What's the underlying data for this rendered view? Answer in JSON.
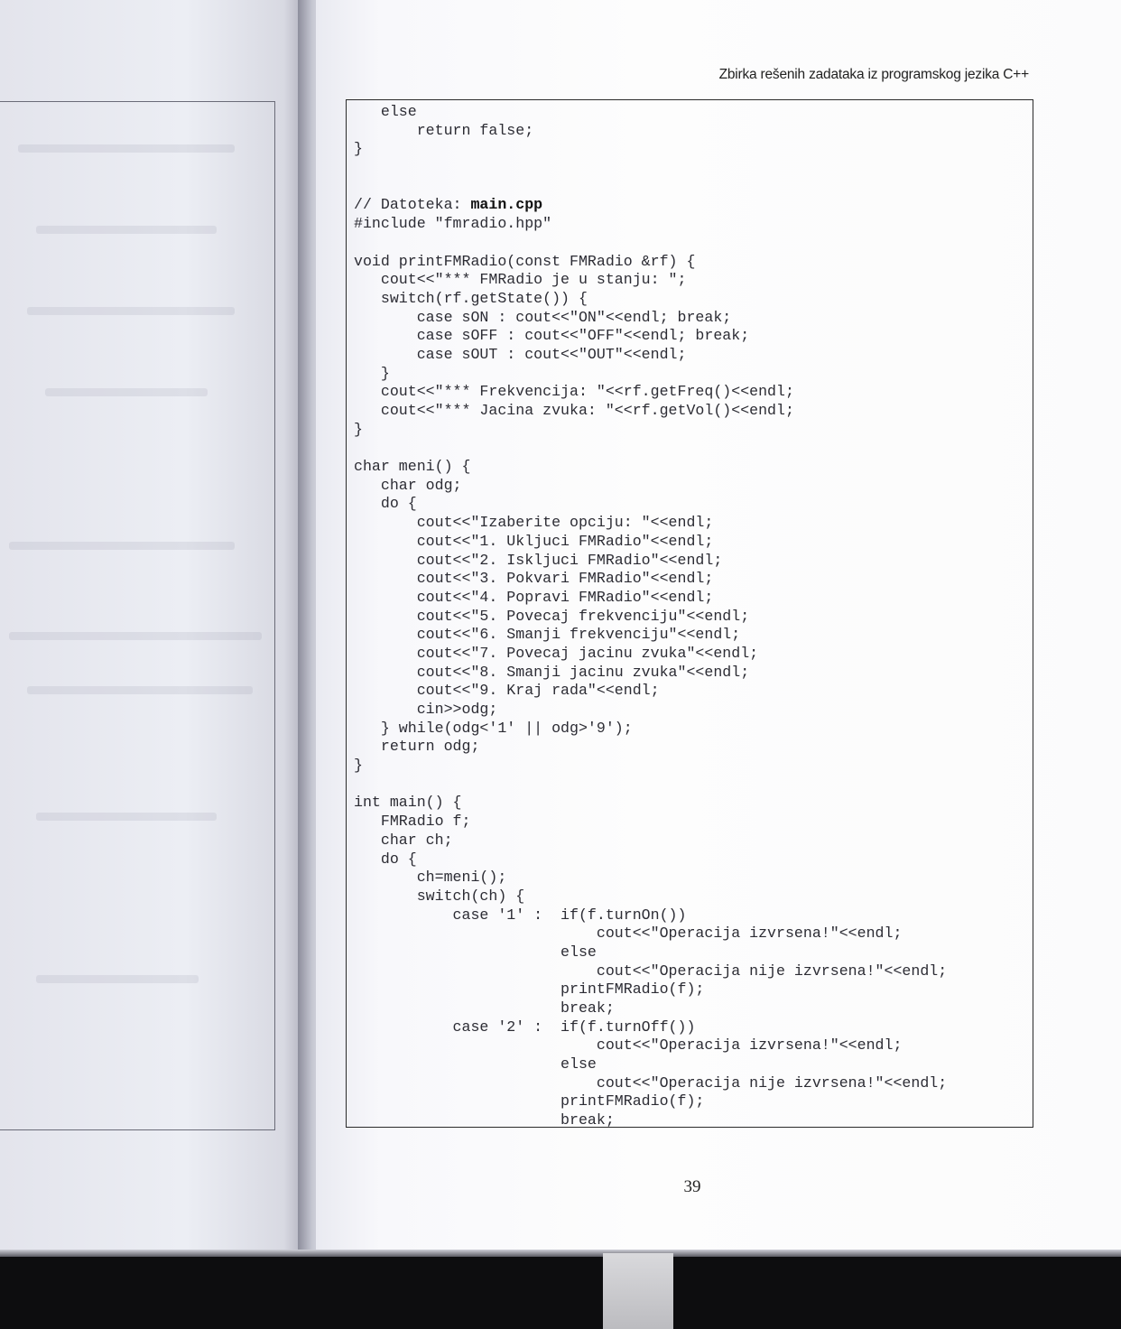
{
  "header": {
    "running_title": "Zbirka rešenih zadataka iz programskog jezika C++"
  },
  "code": {
    "lines": [
      "   else",
      "       return false;",
      "}",
      "",
      "",
      "// Datoteka: ",
      "#include \"fmradio.hpp\"",
      "",
      "void printFMRadio(const FMRadio &rf) {",
      "   cout<<\"*** FMRadio je u stanju: \";",
      "   switch(rf.getState()) {",
      "       case sON : cout<<\"ON\"<<endl; break;",
      "       case sOFF : cout<<\"OFF\"<<endl; break;",
      "       case sOUT : cout<<\"OUT\"<<endl;",
      "   }",
      "   cout<<\"*** Frekvencija: \"<<rf.getFreq()<<endl;",
      "   cout<<\"*** Jacina zvuka: \"<<rf.getVol()<<endl;",
      "}",
      "",
      "char meni() {",
      "   char odg;",
      "   do {",
      "       cout<<\"Izaberite opciju: \"<<endl;",
      "       cout<<\"1. Ukljuci FMRadio\"<<endl;",
      "       cout<<\"2. Iskljuci FMRadio\"<<endl;",
      "       cout<<\"3. Pokvari FMRadio\"<<endl;",
      "       cout<<\"4. Popravi FMRadio\"<<endl;",
      "       cout<<\"5. Povecaj frekvenciju\"<<endl;",
      "       cout<<\"6. Smanji frekvenciju\"<<endl;",
      "       cout<<\"7. Povecaj jacinu zvuka\"<<endl;",
      "       cout<<\"8. Smanji jacinu zvuka\"<<endl;",
      "       cout<<\"9. Kraj rada\"<<endl;",
      "       cin>>odg;",
      "   } while(odg<'1' || odg>'9');",
      "   return odg;",
      "}",
      "",
      "int main() {",
      "   FMRadio f;",
      "   char ch;",
      "   do {",
      "       ch=meni();",
      "       switch(ch) {",
      "           case '1' :  if(f.turnOn())",
      "                           cout<<\"Operacija izvrsena!\"<<endl;",
      "                       else",
      "                           cout<<\"Operacija nije izvrsena!\"<<endl;",
      "                       printFMRadio(f);",
      "                       break;",
      "           case '2' :  if(f.turnOff())",
      "                           cout<<\"Operacija izvrsena!\"<<endl;",
      "                       else",
      "                           cout<<\"Operacija nije izvrsena!\"<<endl;",
      "                       printFMRadio(f);",
      "                       break;"
    ],
    "filename_bold": "main.cpp"
  },
  "footer": {
    "page_number": "39"
  }
}
